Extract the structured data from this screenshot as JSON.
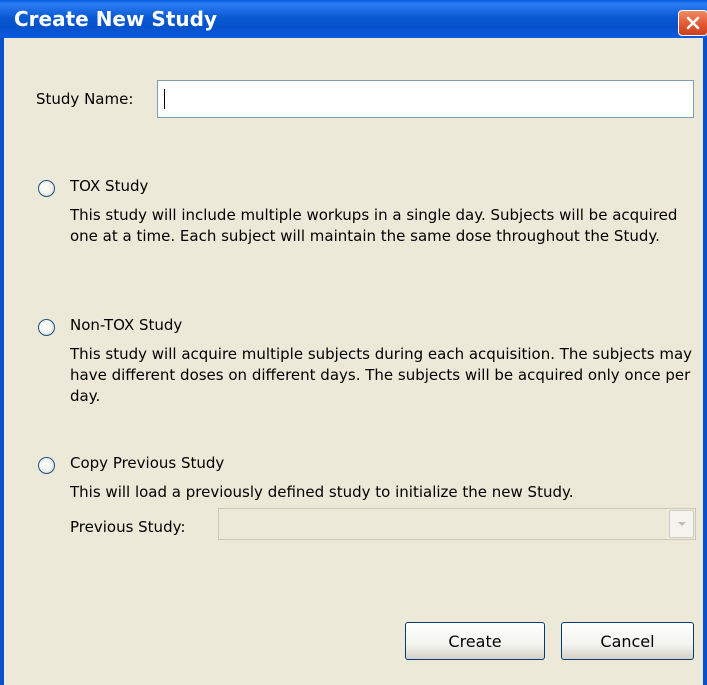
{
  "window": {
    "title": "Create New Study"
  },
  "study_name": {
    "label": "Study Name:",
    "value": ""
  },
  "options": [
    {
      "label": "TOX Study",
      "description": "This study will include multiple workups in a single day.  Subjects will be acquired one at a time.  Each subject will maintain the same dose throughout the Study.",
      "selected": false
    },
    {
      "label": "Non-TOX Study",
      "description": "This study will acquire multiple subjects during each acquisition.  The subjects may have different doses on different days.  The subjects will be acquired only once per day.",
      "selected": false
    },
    {
      "label": "Copy Previous Study",
      "description": "This will load a previously defined study to initialize the new Study.",
      "selected": false
    }
  ],
  "previous_study": {
    "label": "Previous Study:",
    "value": ""
  },
  "buttons": {
    "create": "Create",
    "cancel": "Cancel"
  },
  "colors": {
    "titlebar": "#0a5be0",
    "dialog_bg": "#ece9d8",
    "close_button": "#e0552f"
  }
}
